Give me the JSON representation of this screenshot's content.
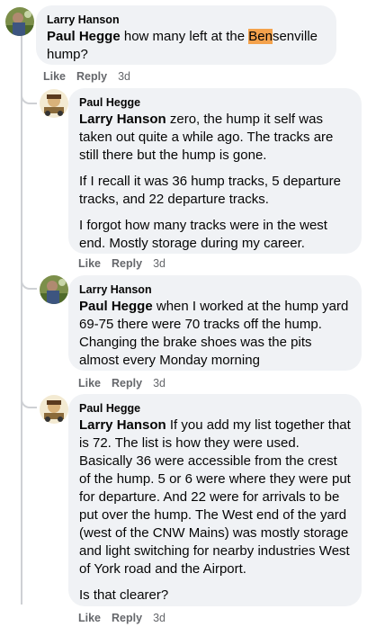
{
  "comments": [
    {
      "author": "Larry Hanson",
      "mention": "Paul Hegge",
      "text_before_hl": " how many left at the ",
      "highlight": "Ben",
      "text_after_hl": "senville hump?",
      "like": "Like",
      "reply": "Reply",
      "time": "3d"
    },
    {
      "author": "Paul Hegge",
      "mention": "Larry Hanson",
      "p1": " zero, the hump it self was taken out quite a while ago. The tracks are still there but the hump is gone.",
      "p2": "If I recall it was 36 hump tracks, 5 departure tracks, and 22 departure tracks.",
      "p3": "I forgot how many tracks were in the west end. Mostly storage during my career.",
      "like": "Like",
      "reply": "Reply",
      "time": "3d"
    },
    {
      "author": "Larry Hanson",
      "mention": "Paul Hegge",
      "p1": " when I worked at the hump yard 69-75 there were 70 tracks off the hump. Changing the brake shoes was the pits almost every Monday morning",
      "like": "Like",
      "reply": "Reply",
      "time": "3d"
    },
    {
      "author": "Paul Hegge",
      "mention": "Larry Hanson",
      "p1": " If you add my list together that is 72. The list is how they were used. Basically 36 were accessible from the crest of the hump. 5 or 6 were where they were put for departure. And 22 were for arrivals to be put over the hump. The West end of the yard (west of the CNW Mains) was mostly storage and light switching for nearby industries West of York road and the Airport.",
      "p2": "Is that clearer?",
      "like": "Like",
      "reply": "Reply",
      "time": "3d"
    }
  ]
}
